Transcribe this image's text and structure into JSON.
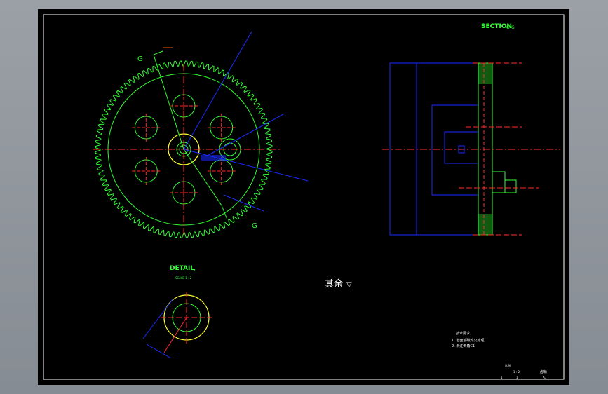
{
  "labels": {
    "section_title": "SECTION",
    "section_suffix": "G-G",
    "cut_mark_top": "G",
    "cut_mark_bottom": "G",
    "detail_title": "DETAIL",
    "detail_suffix": ",",
    "detail_scale": "SCALE 1 : 2",
    "surface_note": "其余",
    "surface_symbol": "▽"
  },
  "tech_notes": {
    "heading": "技术要求",
    "line1": "1. 齿面渗碳淬火处理",
    "line2": "2. 未注倒角C1"
  },
  "title_block": {
    "label_a": "比例",
    "label_b": "1 : 2",
    "drawing_name": "齿轮",
    "sheet_a": "1",
    "sheet_b": "1",
    "sheet_c": "A3"
  },
  "colors": {
    "background": "#000000",
    "frame": "#ffffff",
    "gear": "#33ff33",
    "centerline": "#ff2a2a",
    "dimension": "#1a2cff",
    "detail_ring": "#ffff33",
    "title_text": "#33ff33"
  }
}
